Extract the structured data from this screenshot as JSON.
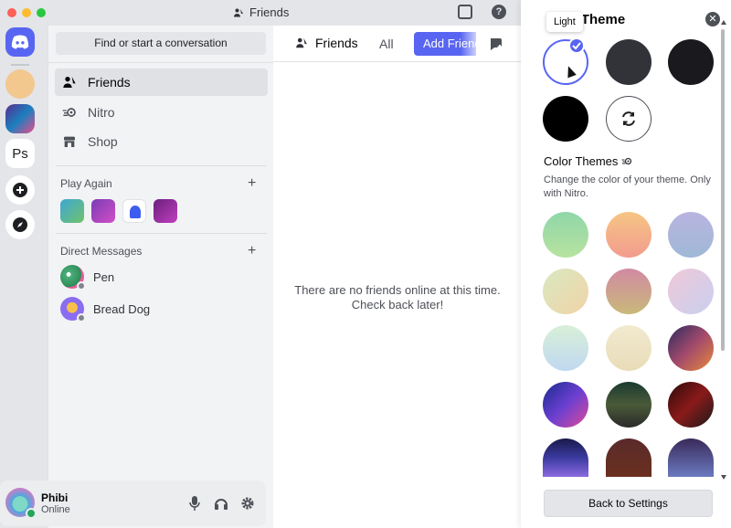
{
  "window": {
    "title": "Friends"
  },
  "sidebar": {
    "search_label": "Find or start a conversation",
    "nav": [
      {
        "label": "Friends",
        "icon": "friends-icon"
      },
      {
        "label": "Nitro",
        "icon": "nitro-icon"
      },
      {
        "label": "Shop",
        "icon": "shop-icon"
      }
    ],
    "play_again_label": "Play Again",
    "direct_messages_label": "Direct Messages",
    "dms": [
      {
        "name": "Pen"
      },
      {
        "name": "Bread Dog"
      }
    ]
  },
  "servers": [
    {
      "icon": "discord-home-icon"
    },
    {
      "icon": "bread-server-icon"
    },
    {
      "icon": "game-server-icon"
    },
    {
      "label": "Ps"
    },
    {
      "icon": "add-server-icon"
    },
    {
      "icon": "explore-icon"
    }
  ],
  "user": {
    "name": "Phibi",
    "status": "Online"
  },
  "main": {
    "tab_friends": "Friends",
    "tab_all": "All",
    "add_friend": "Add Friend",
    "empty_message": "There are no friends online at this time. Check back later!"
  },
  "theme_panel": {
    "title_visible": "w Theme",
    "tooltip": "Light",
    "color_themes_label": "Color Themes",
    "color_themes_desc": "Change the color of your theme. Only with Nitro.",
    "back_button": "Back to Settings",
    "color_swatches": [
      "linear-gradient(180deg,#8fd6a8,#b8e3a0)",
      "linear-gradient(180deg,#f6c584,#f29c8e)",
      "linear-gradient(180deg,#b9b4e0,#9fb8d6)",
      "linear-gradient(135deg,#d8e8c0,#f2d3a8)",
      "linear-gradient(180deg,#d18aa2,#c9b97a)",
      "linear-gradient(135deg,#f0c8d8,#c8d0f0)",
      "linear-gradient(180deg,#d8f0d8,#c0d8f0)",
      "linear-gradient(180deg,#f2ead0,#e8dcb8)",
      "linear-gradient(135deg,#2a2b5e,#a24a6c,#e88a3a)",
      "linear-gradient(135deg,#1a2b8f,#6a3fd0,#e04a9a)",
      "linear-gradient(180deg,#1a3a30,#4a5a38,#2a2a2a)",
      "linear-gradient(135deg,#2a0a0a,#8a1a1a,#1a1a1a)",
      "linear-gradient(180deg,#1a1a4a,#3a3aa0,#8a6ae0)",
      "linear-gradient(180deg,#5a2a2a,#6a3020)",
      "linear-gradient(180deg,#3a2a5a,#6a7ac0)"
    ]
  }
}
